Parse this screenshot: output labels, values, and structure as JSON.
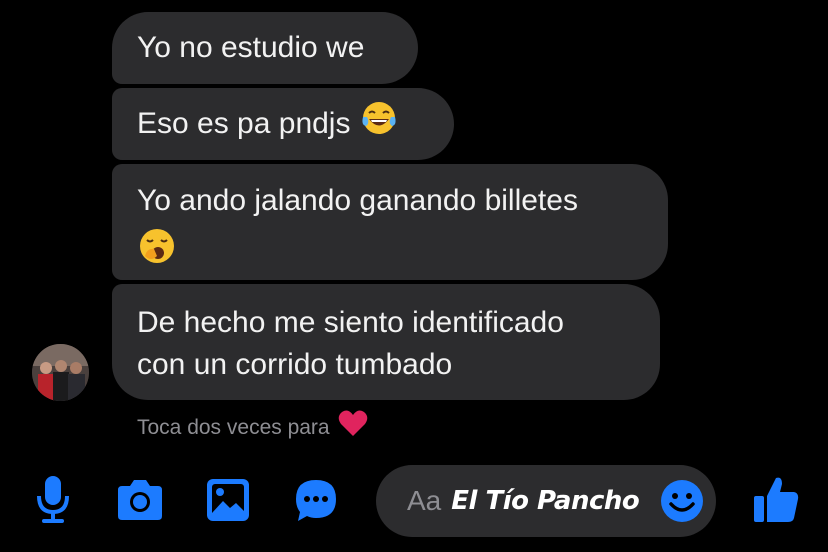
{
  "messages": [
    {
      "text": "Yo no estudio we"
    },
    {
      "text": "Eso es pa pndjs",
      "emoji": "tears-of-joy-emoji"
    },
    {
      "text": "Yo ando jalando ganando billetes",
      "emoji": "yawning-face-emoji"
    },
    {
      "line1": "De hecho me siento identificado",
      "line2": "con un corrido tumbado"
    }
  ],
  "hint": {
    "text": "Toca dos veces para",
    "emoji": "red-heart-emoji"
  },
  "composer": {
    "placeholder": "Aa",
    "overlay": "El Tío Pancho"
  },
  "toolbar": {
    "icons": [
      "microphone-icon",
      "camera-icon",
      "gallery-icon",
      "chat-bubble-icon"
    ],
    "right_icon": "thumbs-up-icon",
    "emoji_icon": "smiley-icon"
  },
  "colors": {
    "background": "#000000",
    "bubble": "#2c2c2e",
    "accent": "#1c7bff",
    "muted_text": "#8e8e93",
    "heart": "#e0245e"
  }
}
